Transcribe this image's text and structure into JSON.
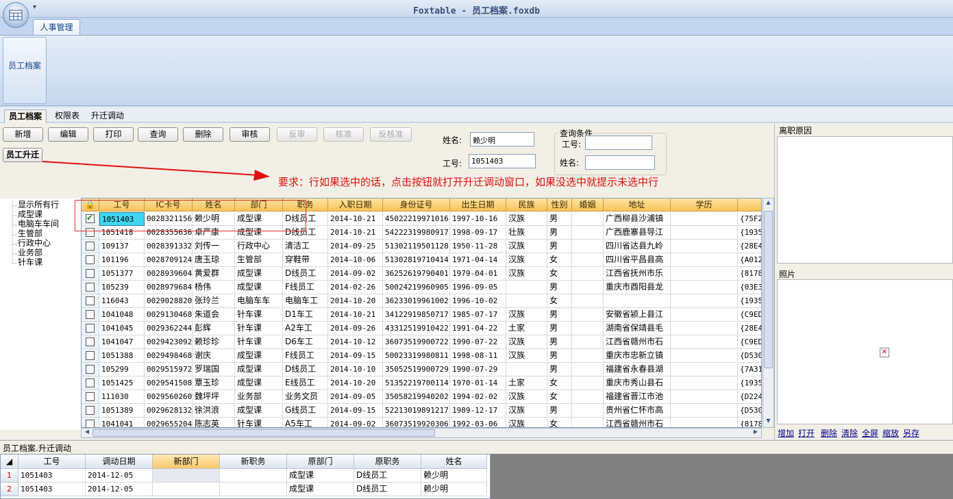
{
  "window": {
    "title": "Foxtable - 员工档案.foxdb",
    "qa_arrow": "▾"
  },
  "ribbon": {
    "tab": "人事管理",
    "button": "员工档案"
  },
  "page_tabs": [
    "员工档案",
    "权限表",
    "升迁调动"
  ],
  "toolbar": {
    "buttons": [
      {
        "label": "新增",
        "enabled": true
      },
      {
        "label": "编辑",
        "enabled": true
      },
      {
        "label": "打印",
        "enabled": true
      },
      {
        "label": "查询",
        "enabled": true
      },
      {
        "label": "删除",
        "enabled": true
      },
      {
        "label": "审核",
        "enabled": true
      },
      {
        "label": "反审",
        "enabled": false
      },
      {
        "label": "核准",
        "enabled": false
      },
      {
        "label": "反核准",
        "enabled": false
      }
    ],
    "promote_button": "员工升迁"
  },
  "form": {
    "name_label": "姓名:",
    "name_value": "赖少明",
    "id_label": "工号:",
    "id_value": "1051403"
  },
  "query": {
    "title": "查询条件",
    "id_label": "工号:",
    "name_label": "姓名:",
    "id_value": "",
    "name_value": ""
  },
  "annotation": "要求：行如果选中的话，点击按钮就打开升迁调动窗口，如果没选中就提示未选中行",
  "tree": [
    "显示所有行",
    "成型课",
    "电脑车车间",
    "生管部",
    "行政中心",
    "业务部",
    "针车课"
  ],
  "grid": {
    "columns": [
      "工号",
      "IC卡号",
      "姓名",
      "部门",
      "职务",
      "入职日期",
      "身份证号",
      "出生日期",
      "民族",
      "性别",
      "婚姻",
      "地址",
      "学历",
      ""
    ],
    "rows": [
      {
        "checked": true,
        "cells": [
          "1051403",
          "0028321156",
          "赖少明",
          "成型课",
          "D线员工",
          "2014-10-21",
          "45022219971016",
          "1997-10-16",
          "汉族",
          "男",
          "",
          "广西柳县沙浦镇",
          "",
          "{75F2"
        ]
      },
      {
        "checked": false,
        "cells": [
          "1051418",
          "0028355636",
          "卓严康",
          "成型课",
          "D线员工",
          "2014-10-21",
          "54222319980917",
          "1998-09-17",
          "壮族",
          "男",
          "",
          "广西鹿寨县导江",
          "",
          "{1935"
        ]
      },
      {
        "checked": false,
        "cells": [
          "109137",
          "0028391332",
          "刘传一",
          "行政中心",
          "清洁工",
          "2014-09-25",
          "51302119501128",
          "1950-11-28",
          "汉族",
          "男",
          "",
          "四川省达县九岭",
          "",
          "{28E4"
        ]
      },
      {
        "checked": false,
        "cells": [
          "101196",
          "0028709124",
          "唐玉琼",
          "生管部",
          "穿鞋带",
          "2014-10-06",
          "51302819710414",
          "1971-04-14",
          "汉族",
          "女",
          "",
          "四川省平昌县高",
          "",
          "{A012"
        ]
      },
      {
        "checked": false,
        "cells": [
          "1051377",
          "0028939604",
          "黄爱群",
          "成型课",
          "D线员工",
          "2014-09-02",
          "36252619790401",
          "1979-04-01",
          "汉族",
          "女",
          "",
          "江西省抚州市乐",
          "",
          "{8178"
        ]
      },
      {
        "checked": false,
        "cells": [
          "105239",
          "0028979684",
          "杨伟",
          "成型课",
          "F线员工",
          "2014-02-26",
          "50024219960905",
          "1996-09-05",
          "",
          "男",
          "",
          "重庆市酉阳县龙",
          "",
          "{03E3"
        ]
      },
      {
        "checked": false,
        "cells": [
          "116043",
          "0029028820",
          "张玲兰",
          "电脑车车",
          "电脑车工",
          "2014-10-20",
          "36233019961002",
          "1996-10-02",
          "",
          "女",
          "",
          "",
          "",
          "{1935"
        ]
      },
      {
        "checked": false,
        "cells": [
          "1041048",
          "0029130468",
          "朱道会",
          "针车课",
          "D1车工",
          "2014-10-21",
          "34122919850717",
          "1985-07-17",
          "汉族",
          "男",
          "",
          "安徽省颍上县江",
          "",
          "{C9ED"
        ]
      },
      {
        "checked": false,
        "cells": [
          "1041045",
          "0029362244",
          "彭辉",
          "针车课",
          "A2车工",
          "2014-09-26",
          "43312519910422",
          "1991-04-22",
          "土家",
          "男",
          "",
          "湖南省保靖县毛",
          "",
          "{28E4"
        ]
      },
      {
        "checked": false,
        "cells": [
          "1041047",
          "0029423092",
          "赖珍珍",
          "针车课",
          "D6车工",
          "2014-10-12",
          "36073519900722",
          "1990-07-22",
          "汉族",
          "男",
          "",
          "江西省赣州市石",
          "",
          "{C9ED"
        ]
      },
      {
        "checked": false,
        "cells": [
          "1051388",
          "0029498468",
          "谢庆",
          "成型课",
          "F线员工",
          "2014-09-15",
          "50023319980811",
          "1998-08-11",
          "汉族",
          "男",
          "",
          "重庆市忠新立镇",
          "",
          "{D530"
        ]
      },
      {
        "checked": false,
        "cells": [
          "105299",
          "0029515972",
          "罗瑞国",
          "成型课",
          "D线员工",
          "2014-10-10",
          "35052519900729",
          "1990-07-29",
          "",
          "男",
          "",
          "福建省永春县湖",
          "",
          "{7A31"
        ]
      },
      {
        "checked": false,
        "cells": [
          "1051425",
          "0029541508",
          "覃玉珍",
          "成型课",
          "E线员工",
          "2014-10-20",
          "51352219700114",
          "1970-01-14",
          "土家",
          "女",
          "",
          "重庆市秀山县石",
          "",
          "{1935"
        ]
      },
      {
        "checked": false,
        "cells": [
          "111030",
          "0029560260",
          "魏坪坪",
          "业务部",
          "业务文员",
          "2014-09-05",
          "35058219940202",
          "1994-02-02",
          "汉族",
          "女",
          "",
          "福建省晋江市池",
          "",
          "{D224"
        ]
      },
      {
        "checked": false,
        "cells": [
          "1051389",
          "0029628132",
          "徐洪浪",
          "成型课",
          "G线员工",
          "2014-09-15",
          "52213019891217",
          "1989-12-17",
          "汉族",
          "男",
          "",
          "贵州省仁怀市高",
          "",
          "{D530"
        ]
      },
      {
        "checked": false,
        "cells": [
          "1041041",
          "0029655204",
          "陈志英",
          "针车课",
          "A5车工",
          "2014-09-02",
          "36073519920306",
          "1992-03-06",
          "汉族",
          "女",
          "",
          "江西省赣州市石",
          "",
          "{8178"
        ]
      }
    ]
  },
  "right_panel": {
    "resign_title": "离职原因",
    "photo_title": "照片",
    "links": [
      "增加",
      "打开",
      "删除",
      "清除",
      "全屏",
      "缩放",
      "另存"
    ]
  },
  "subtable": {
    "caption": "员工档案.升迁调动",
    "columns": [
      "工号",
      "调动日期",
      "新部门",
      "新职务",
      "原部门",
      "原职务",
      "姓名"
    ],
    "rows": [
      {
        "num": "1",
        "cells": [
          "1051403",
          "2014-12-05",
          "",
          "",
          "成型课",
          "D线员工",
          "赖少明"
        ]
      },
      {
        "num": "2",
        "cells": [
          "1051403",
          "2014-12-05",
          "",
          "",
          "成型课",
          "D线员工",
          "赖少明"
        ]
      }
    ]
  }
}
